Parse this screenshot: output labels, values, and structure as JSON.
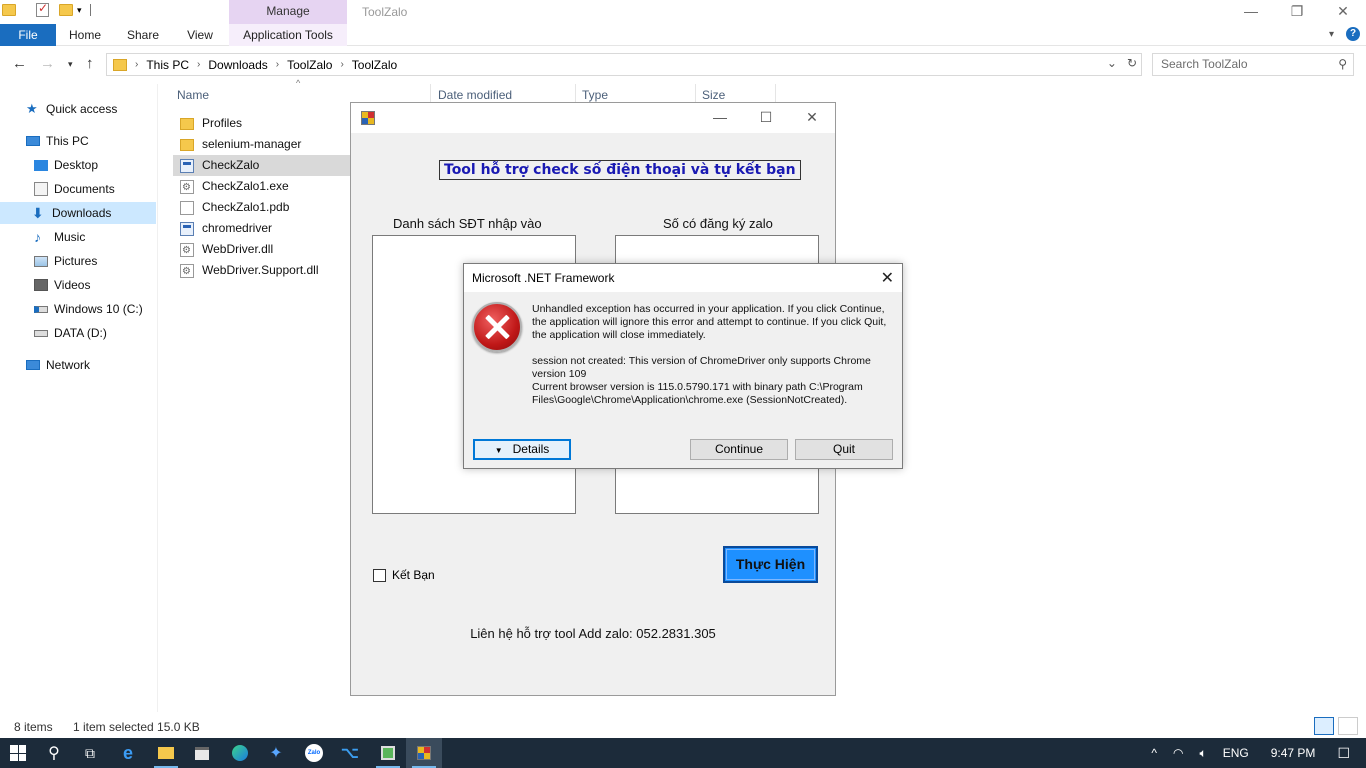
{
  "window": {
    "title": "ToolZalo",
    "manage_tab": "Manage",
    "controls": {
      "minimize": "—",
      "restore": "❐",
      "close": "✕"
    }
  },
  "ribbon": {
    "file": "File",
    "home": "Home",
    "share": "Share",
    "view": "View",
    "app_tools": "Application Tools"
  },
  "address": {
    "breadcrumbs": [
      "This PC",
      "Downloads",
      "ToolZalo",
      "ToolZalo"
    ],
    "search_placeholder": "Search ToolZalo"
  },
  "nav": {
    "quick_access": "Quick access",
    "this_pc": "This PC",
    "desktop": "Desktop",
    "documents": "Documents",
    "downloads": "Downloads",
    "music": "Music",
    "pictures": "Pictures",
    "videos": "Videos",
    "drive_c": "Windows 10 (C:)",
    "drive_d": "DATA (D:)",
    "network": "Network"
  },
  "columns": {
    "name": "Name",
    "date_modified": "Date modified",
    "type": "Type",
    "size": "Size"
  },
  "files": [
    {
      "name": "Profiles",
      "icon": "folder-icon"
    },
    {
      "name": "selenium-manager",
      "icon": "folder-icon"
    },
    {
      "name": "CheckZalo",
      "icon": "app-config-icon"
    },
    {
      "name": "CheckZalo1.exe",
      "icon": "exe-icon"
    },
    {
      "name": "CheckZalo1.pdb",
      "icon": "file-icon"
    },
    {
      "name": "chromedriver",
      "icon": "exe-icon"
    },
    {
      "name": "WebDriver.dll",
      "icon": "dll-icon"
    },
    {
      "name": "WebDriver.Support.dll",
      "icon": "dll-icon"
    }
  ],
  "status": {
    "count": "8 items",
    "selection": "1 item selected  15.0 KB"
  },
  "app": {
    "heading": "Tool hỗ trợ check số điện thoại và tự kết bạn",
    "left_list_label": "Danh sách SĐT nhập vào",
    "right_list_label": "Số có đăng ký zalo",
    "checkbox_label": "Kết Bạn",
    "run_button": "Thực Hiện",
    "contact": "Liên hệ hỗ trợ tool Add zalo: 052.2831.305"
  },
  "dialog": {
    "title": "Microsoft .NET Framework",
    "message1": "Unhandled exception has occurred in your application. If you click Continue, the application will ignore this error and attempt to continue. If you click Quit, the application will close immediately.",
    "message2": "session not created: This version of ChromeDriver only supports Chrome version 109\nCurrent browser version is 115.0.5790.171 with binary path C:\\Program Files\\Google\\Chrome\\Application\\chrome.exe (SessionNotCreated).",
    "details": "Details",
    "continue": "Continue",
    "quit": "Quit"
  },
  "taskbar": {
    "language": "ENG",
    "time": "9:47 PM"
  },
  "colors": {
    "accent": "#1a6dbf",
    "selection": "#cce8ff",
    "run_button": "#1e90ff",
    "heading_text": "#1a1ab3",
    "taskbar": "#1c2b3a"
  }
}
